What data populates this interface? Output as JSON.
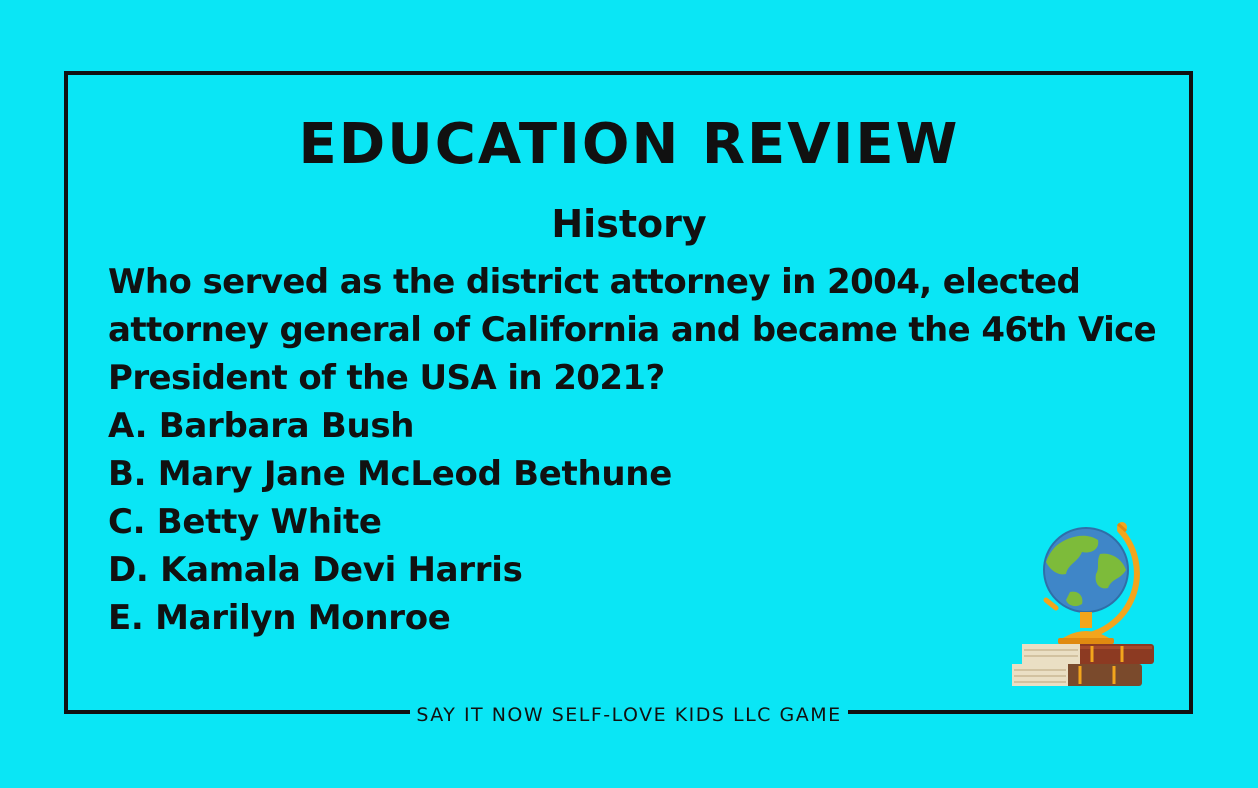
{
  "card": {
    "title": "EDUCATION REVIEW",
    "subject": "History",
    "question": "Who served as the district attorney in 2004, elected attorney general of California and became the 46th Vice President of the USA in 2021?",
    "options": [
      "A. Barbara Bush",
      "B. Mary Jane McLeod Bethune",
      "C. Betty White",
      "D. Kamala Devi Harris",
      "E. Marilyn Monroe"
    ],
    "footer": "SAY IT NOW SELF-LOVE KIDS LLC GAME"
  },
  "illustration": {
    "icon": "globe-on-books-icon"
  },
  "colors": {
    "background": "#0ae6f5",
    "text": "#111111",
    "ocean": "#3f86c8",
    "land": "#7dbb3a",
    "stand": "#f3a51c",
    "book_red": "#8c3a22",
    "book_brown": "#7a4a2c"
  }
}
